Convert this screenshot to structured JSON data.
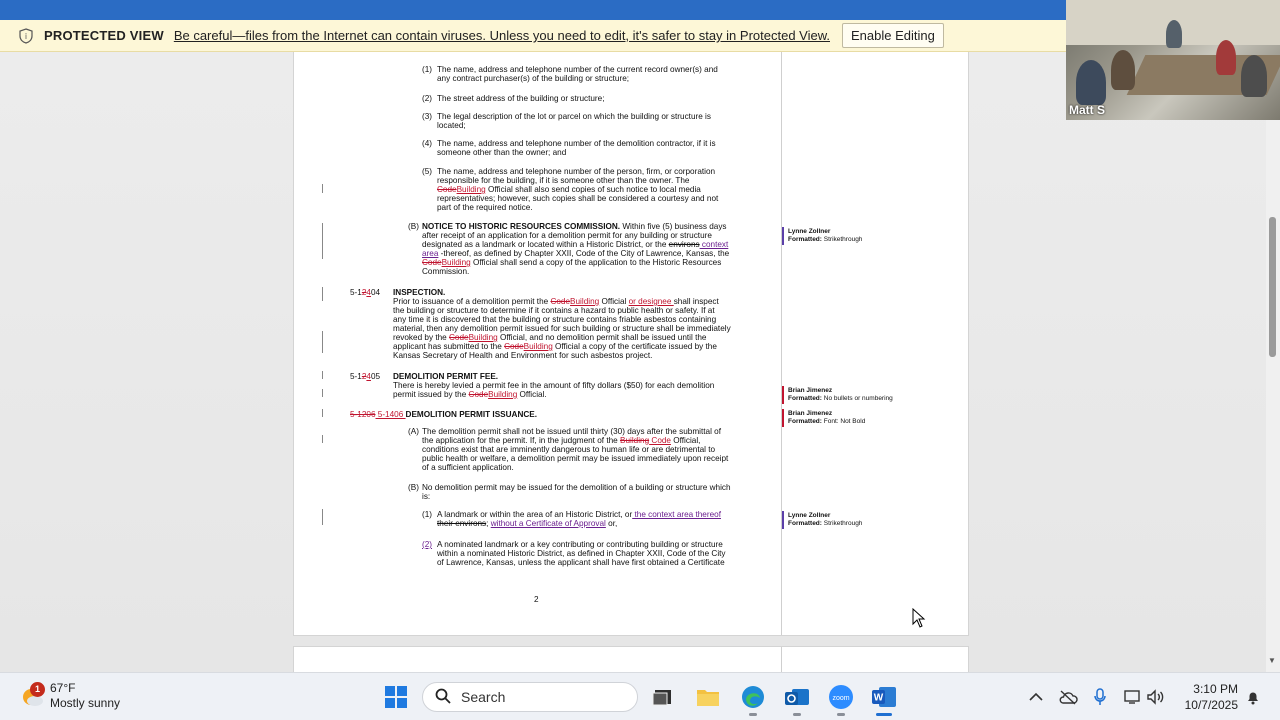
{
  "protected_view": {
    "title": "PROTECTED VIEW",
    "message": "Be careful—files from the Internet can contain viruses. Unless you need to edit, it's safer to stay in Protected View.",
    "button": "Enable Editing"
  },
  "document": {
    "item1_a": "(1)",
    "item1_b": "The name, address and telephone number of the current record owner(s) and",
    "item1_c": "any contract purchaser(s) of the building or structure;",
    "item2_a": "(2)",
    "item2_b": "The street address of the building or structure;",
    "item3_a": "(3)",
    "item3_b": "The legal description of the lot or parcel on which the building or structure is",
    "item3_c": "located;",
    "item4_a": "(4)",
    "item4_b": "The name, address and telephone number of the demolition contractor, if it is",
    "item4_c": "someone other than the owner; and",
    "item5_a": "(5)",
    "item5_b": "The name, address and telephone number of the person, firm, or corporation",
    "item5_c": "responsible for the building, if it is someone other than the owner.   The",
    "item5_d_del": "Code",
    "item5_d_ins": "Building",
    "item5_d": " Official shall also send copies of such notice to local media",
    "item5_e": "representatives; however, such copies shall be considered a courtesy and not",
    "item5_f": "part of the required notice.",
    "B_label": "(B)",
    "B_title": "NOTICE TO HISTORIC RESOURCES COMMISSION.",
    "B_l1": "  Within five (5) business days",
    "B_l2": "after receipt of an application for a demolition permit for any building or structure",
    "B_l3": "designated as a landmark or located within a Historic District, or the ",
    "B_l3_del": "environs",
    "B_l3_ins": " context",
    "B_l4_ins": "area",
    "B_l4": " -thereof, as defined by Chapter XXII, Code of the City of Lawrence, Kansas, the",
    "B_l5_del": "Code",
    "B_l5_ins": "Building",
    "B_l5": " Official shall send a copy of the application to the Historic Resources",
    "B_l6": "Commission.",
    "s1204_a": "5-1",
    "s1204_del": "2",
    "s1204_ins": "4",
    "s1204_b": "04",
    "s1204_title": "INSPECTION.",
    "s1204_l1a": "Prior to issuance of a demolition permit the ",
    "s1204_l1_del": "Code",
    "s1204_l1_ins": "Building",
    "s1204_l1b": " Official ",
    "s1204_l1_ins2": "or designee ",
    "s1204_l1c": "shall inspect",
    "s1204_l2": "the building or structure to determine if it contains a hazard to public health or safety.  If at",
    "s1204_l3": "any time it is discovered that the building or structure contains friable asbestos containing",
    "s1204_l4": "material, then any demolition permit issued for such building or structure shall be immediately",
    "s1204_l5a": "revoked by the ",
    "s1204_l5_del": "Code",
    "s1204_l5_ins": "Building",
    "s1204_l5b": " Official, and no demolition permit shall be issued until the",
    "s1204_l6a": "applicant has submitted to the ",
    "s1204_l6_del": "Code",
    "s1204_l6_ins": "Building",
    "s1204_l6b": " Official a copy of the certificate issued by the",
    "s1204_l7": "Kansas Secretary of Health and Environment for such asbestos project.",
    "s1205_a": "5-1",
    "s1205_del": "2",
    "s1205_ins": "4",
    "s1205_b": "05",
    "s1205_title": "DEMOLITION PERMIT FEE.",
    "s1205_l1": "There is hereby levied a permit fee in the amount of fifty dollars ($50) for each demolition",
    "s1205_l2a": "permit issued by the ",
    "s1205_l2_del": "Code",
    "s1205_l2_ins": "Building",
    "s1205_l2b": " Official.",
    "s1206_del": "5-1206",
    "s1206_ins": " 5-1406 ",
    "s1206_title": "DEMOLITION PERMIT ISSUANCE.",
    "A2_label": "(A)",
    "A2_l1": "The demolition permit shall not be issued until thirty (30) days after the submittal of",
    "A2_l2a": "the application for the permit.  If, in the judgment of the ",
    "A2_l2_del": "Building",
    "A2_l2_ins": " Code",
    "A2_l2b": " Official,",
    "A2_l3": "conditions exist that are imminently dangerous to human life or are detrimental to",
    "A2_l4": "public health or welfare, a demolition permit may be issued immediately upon receipt",
    "A2_l5": "of a sufficient application.",
    "B2_label": "(B)",
    "B2_l1": "No demolition permit may be issued for the demolition of a building or structure which",
    "B2_l2": "is:",
    "B2_1_label": "(1)",
    "B2_1_l1a": "A landmark or within the area of an Historic District, or",
    "B2_1_l1_ins": " the context area thereof",
    "B2_1_l2_del": "their environs",
    "B2_1_l2a": "; ",
    "B2_1_l2_ins": "without a Certificate of Approval",
    "B2_1_l2b": " or,",
    "B2_2_label": "(2) ",
    "B2_2_l1": "A nominated landmark or a key contributing or contributing building or structure",
    "B2_2_l2": "within a nominated Historic District, as defined in Chapter XXII, Code of the City",
    "B2_2_l3": "of Lawrence, Kansas, unless the applicant shall have first obtained a Certificate",
    "page_number": "2"
  },
  "comments": [
    {
      "author": "Lynne Zollner",
      "label": "Formatted:",
      "value": " Strikethrough",
      "color": "#5b3fa8"
    },
    {
      "author": "Brian Jimenez",
      "label": "Formatted:",
      "value": " No bullets or numbering",
      "color": "#c0142f"
    },
    {
      "author": "Brian Jimenez",
      "label": "Formatted:",
      "value": " Font: Not Bold",
      "color": "#c0142f"
    },
    {
      "author": "Lynne Zollner",
      "label": "Formatted:",
      "value": " Strikethrough",
      "color": "#5b3fa8"
    }
  ],
  "video": {
    "participant_name": "Matt S"
  },
  "taskbar": {
    "weather_badge": "1",
    "temperature": "67°F",
    "condition": "Mostly sunny",
    "search_placeholder": "Search",
    "time": "3:10 PM",
    "date": "10/7/2025"
  },
  "colors": {
    "titlebar": "#2b6cc4",
    "deletion": "#c0142f",
    "lynne": "#5b3fa8"
  }
}
